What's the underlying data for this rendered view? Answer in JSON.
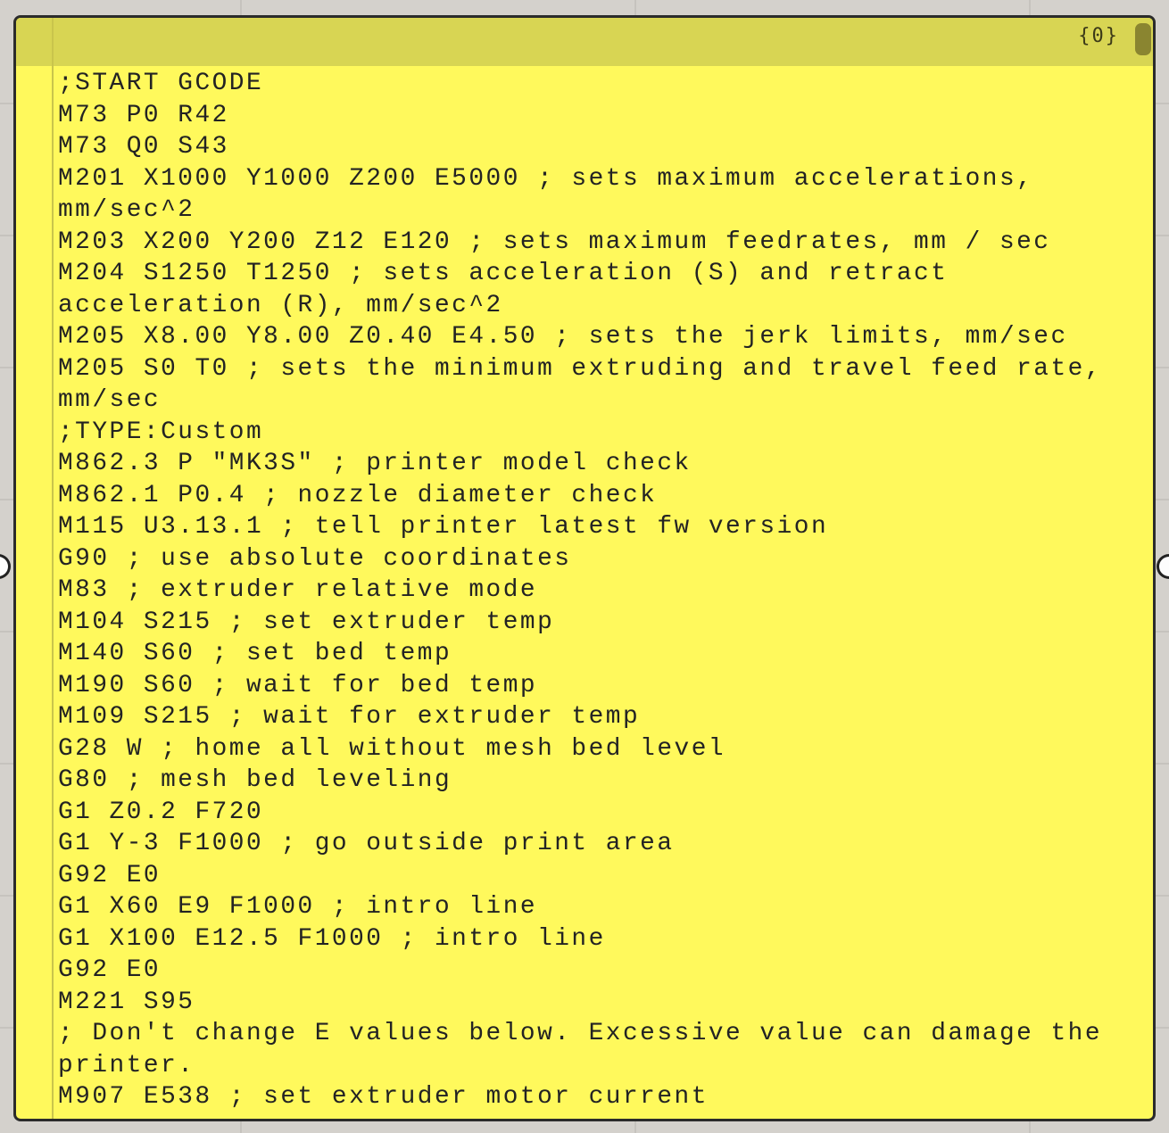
{
  "panel": {
    "count_label": "{0}",
    "lines": [
      ";START GCODE",
      "M73 P0 R42",
      "M73 Q0 S43",
      "M201 X1000 Y1000 Z200 E5000 ; sets maximum accelerations,",
      "mm/sec^2",
      "M203 X200 Y200 Z12 E120 ; sets maximum feedrates, mm / sec",
      "M204 S1250 T1250 ; sets acceleration (S) and retract",
      "acceleration (R), mm/sec^2",
      "M205 X8.00 Y8.00 Z0.40 E4.50 ; sets the jerk limits, mm/sec",
      "M205 S0 T0 ; sets the minimum extruding and travel feed rate,",
      "mm/sec",
      ";TYPE:Custom",
      "M862.3 P \"MK3S\" ; printer model check",
      "M862.1 P0.4 ; nozzle diameter check",
      "M115 U3.13.1 ; tell printer latest fw version",
      "G90 ; use absolute coordinates",
      "M83 ; extruder relative mode",
      "M104 S215 ; set extruder temp",
      "M140 S60 ; set bed temp",
      "M190 S60 ; wait for bed temp",
      "M109 S215 ; wait for extruder temp",
      "G28 W ; home all without mesh bed level",
      "G80 ; mesh bed leveling",
      "G1 Z0.2 F720",
      "G1 Y-3 F1000 ; go outside print area",
      "G92 E0",
      "G1 X60 E9 F1000 ; intro line",
      "G1 X100 E12.5 F1000 ; intro line",
      "G92 E0",
      "M221 S95",
      "; Don't change E values below. Excessive value can damage the",
      "printer.",
      "M907 E538 ; set extruder motor current"
    ]
  },
  "colors": {
    "panel_background": "#fff95c",
    "title_bar": "#d8d553",
    "canvas": "#d4d1cc",
    "text": "#232323"
  }
}
